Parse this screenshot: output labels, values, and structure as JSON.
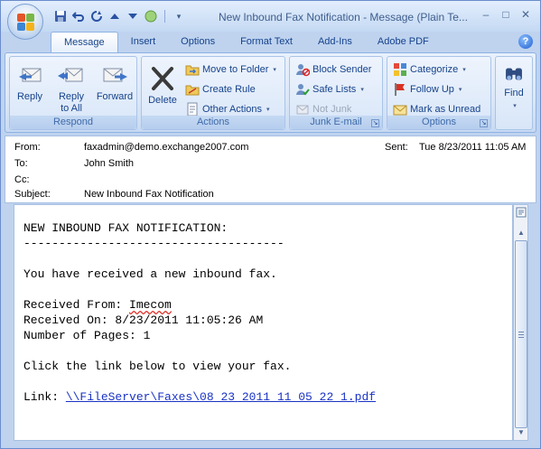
{
  "window": {
    "title": "New Inbound Fax Notification - Message (Plain Te...",
    "controls": {
      "minimize": "–",
      "maximize": "□",
      "close": "✕"
    }
  },
  "qat": {
    "more_glyph": "▾"
  },
  "tabs": [
    {
      "label": "Message",
      "active": true
    },
    {
      "label": "Insert"
    },
    {
      "label": "Options"
    },
    {
      "label": "Format Text"
    },
    {
      "label": "Add-Ins"
    },
    {
      "label": "Adobe PDF"
    }
  ],
  "help": {
    "glyph": "?"
  },
  "ribbon": {
    "respond": {
      "label": "Respond",
      "reply": "Reply",
      "reply_all_line1": "Reply",
      "reply_all_line2": "to All",
      "forward": "Forward"
    },
    "actions": {
      "label": "Actions",
      "delete": "Delete",
      "move_to_folder": "Move to Folder",
      "create_rule": "Create Rule",
      "other_actions": "Other Actions"
    },
    "junk": {
      "label": "Junk E-mail",
      "block_sender": "Block Sender",
      "safe_lists": "Safe Lists",
      "not_junk": "Not Junk"
    },
    "options": {
      "label": "Options",
      "categorize": "Categorize",
      "follow_up": "Follow Up",
      "mark_as_unread": "Mark as Unread"
    },
    "find": {
      "label": "Find"
    },
    "caret_glyph": "▾",
    "launcher_glyph": "↘"
  },
  "header": {
    "from_label": "From:",
    "from_value": "faxadmin@demo.exchange2007.com",
    "to_label": "To:",
    "to_value": "John Smith",
    "cc_label": "Cc:",
    "cc_value": "",
    "subject_label": "Subject:",
    "subject_value": "New Inbound Fax Notification",
    "sent_label": "Sent:",
    "sent_value": "Tue 8/23/2011 11:05 AM"
  },
  "body": {
    "heading": "NEW INBOUND FAX NOTIFICATION:",
    "rule": "-------------------------------------",
    "intro": "You have received a new inbound fax.",
    "received_from_label": "Received From: ",
    "received_from_value": "Imecom",
    "received_on": "Received On: 8/23/2011 11:05:26 AM",
    "pages": "Number of Pages: 1",
    "instruction": "Click the link below to view your fax.",
    "link_label": "Link: ",
    "link_value": "\\\\FileServer\\Faxes\\08 23 2011 11 05 22 1.pdf"
  },
  "scrollbar": {
    "up_glyph": "▲",
    "down_glyph": "▼"
  },
  "colors": {
    "frame": "#bfd3ef",
    "ribbon_text": "#15428b",
    "link": "#1a33c4",
    "spellcheck": "#e0322b"
  }
}
